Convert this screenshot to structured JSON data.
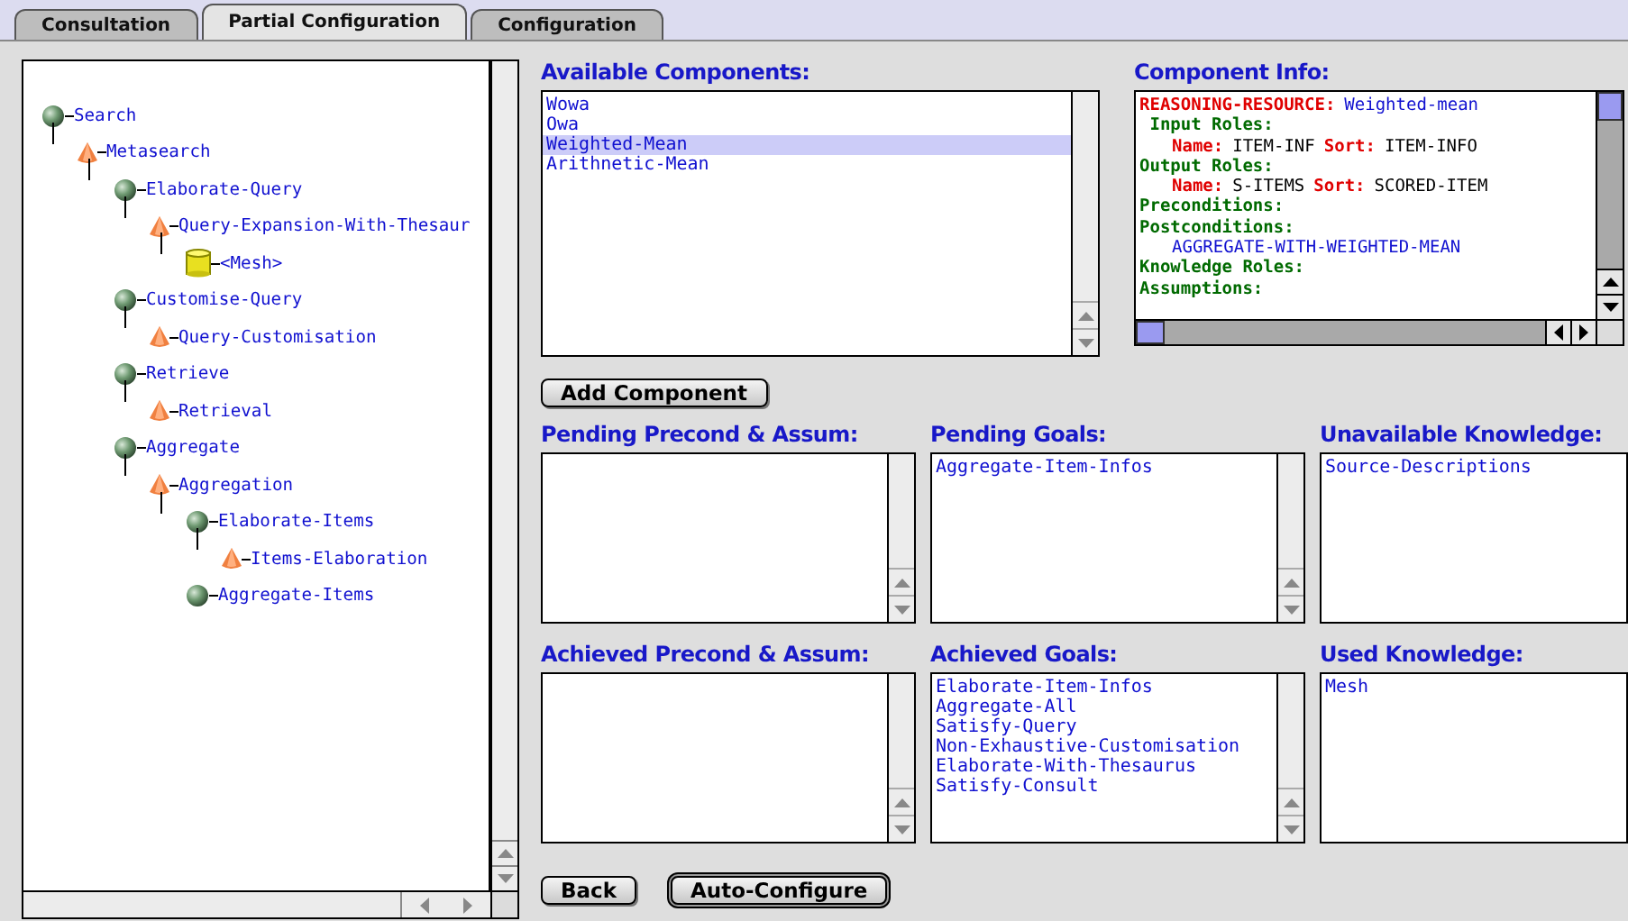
{
  "tabs": [
    {
      "label": "Consultation",
      "selected": false
    },
    {
      "label": "Partial Configuration",
      "selected": true
    },
    {
      "label": "Configuration",
      "selected": false
    }
  ],
  "tree": [
    {
      "kind": "task",
      "label": "Search",
      "children": [
        {
          "kind": "method",
          "label": "Metasearch",
          "children": [
            {
              "kind": "task",
              "label": "Elaborate-Query",
              "children": [
                {
                  "kind": "method",
                  "label": "Query-Expansion-With-Thesaur",
                  "children": [
                    {
                      "kind": "knowledge",
                      "label": "<Mesh>"
                    }
                  ]
                }
              ]
            },
            {
              "kind": "task",
              "label": "Customise-Query",
              "children": [
                {
                  "kind": "method",
                  "label": "Query-Customisation"
                }
              ]
            },
            {
              "kind": "task",
              "label": "Retrieve",
              "children": [
                {
                  "kind": "method",
                  "label": "Retrieval"
                }
              ]
            },
            {
              "kind": "task",
              "label": "Aggregate",
              "children": [
                {
                  "kind": "method",
                  "label": "Aggregation",
                  "children": [
                    {
                      "kind": "task",
                      "label": "Elaborate-Items",
                      "children": [
                        {
                          "kind": "method",
                          "label": "Items-Elaboration"
                        }
                      ]
                    },
                    {
                      "kind": "task",
                      "label": "Aggregate-Items"
                    }
                  ]
                }
              ]
            }
          ]
        }
      ]
    }
  ],
  "available_components": {
    "heading": "Available Components:",
    "items": [
      {
        "label": "Wowa",
        "selected": false
      },
      {
        "label": "Owa",
        "selected": false
      },
      {
        "label": "Weighted-Mean",
        "selected": true
      },
      {
        "label": "Arithnetic-Mean",
        "selected": false
      }
    ]
  },
  "component_info": {
    "heading": "Component Info:",
    "lines": [
      {
        "indented": false,
        "segments": [
          {
            "kind": "key",
            "text": "REASONING-RESOURCE:"
          },
          {
            "kind": "value",
            "text": "Weighted-mean"
          }
        ]
      },
      {
        "indented": false,
        "segments": [
          {
            "kind": "section",
            "text": " Input Roles:"
          }
        ]
      },
      {
        "indented": true,
        "segments": [
          {
            "kind": "key",
            "text": "Name:"
          },
          {
            "kind": "plain",
            "text": "ITEM-INF"
          },
          {
            "kind": "key",
            "text": "Sort:"
          },
          {
            "kind": "plain",
            "text": "ITEM-INFO"
          }
        ]
      },
      {
        "indented": false,
        "segments": [
          {
            "kind": "section",
            "text": "Output Roles:"
          }
        ]
      },
      {
        "indented": true,
        "segments": [
          {
            "kind": "key",
            "text": "Name:"
          },
          {
            "kind": "plain",
            "text": "S-ITEMS"
          },
          {
            "kind": "key",
            "text": "Sort:"
          },
          {
            "kind": "plain",
            "text": "SCORED-ITEM"
          }
        ]
      },
      {
        "indented": false,
        "segments": [
          {
            "kind": "section",
            "text": "Preconditions:"
          }
        ]
      },
      {
        "indented": false,
        "segments": [
          {
            "kind": "section",
            "text": "Postconditions:"
          }
        ]
      },
      {
        "indented": true,
        "segments": [
          {
            "kind": "value",
            "text": "AGGREGATE-WITH-WEIGHTED-MEAN"
          }
        ]
      },
      {
        "indented": false,
        "segments": [
          {
            "kind": "section",
            "text": "Knowledge Roles:"
          }
        ]
      },
      {
        "indented": false,
        "segments": [
          {
            "kind": "section",
            "text": "Assumptions:"
          }
        ]
      }
    ]
  },
  "add_button": "Add Component",
  "panels": [
    {
      "heading": "Pending Precond & Assum:",
      "scrollbar": true
    },
    {
      "heading": "Pending Goals:",
      "scrollbar": true,
      "items": [
        "Aggregate-Item-Infos"
      ]
    },
    {
      "heading": "Unavailable Knowledge:",
      "scrollbar": false,
      "items": [
        "Source-Descriptions"
      ]
    },
    {
      "heading": "Achieved Precond & Assum:",
      "scrollbar": true
    },
    {
      "heading": "Achieved Goals:",
      "scrollbar": true,
      "items": [
        "Elaborate-Item-Infos",
        "Aggregate-All",
        "Satisfy-Query",
        "Non-Exhaustive-Customisation",
        "Elaborate-With-Thesaurus",
        "Satisfy-Consult"
      ]
    },
    {
      "heading": "Used Knowledge:",
      "scrollbar": false,
      "items": [
        "Mesh"
      ]
    }
  ],
  "buttons": [
    {
      "label": "Back",
      "default": false
    },
    {
      "label": "Auto-Configure",
      "default": true
    }
  ]
}
